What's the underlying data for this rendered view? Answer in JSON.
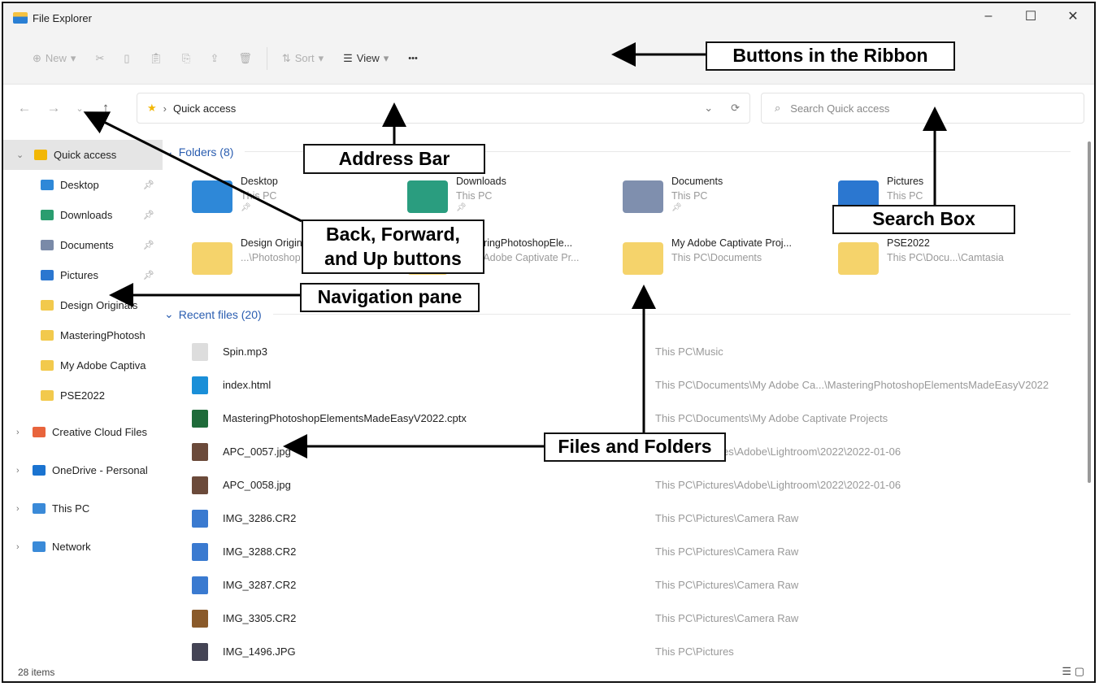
{
  "window": {
    "title": "File Explorer",
    "controls": [
      "–",
      "☐",
      "✕"
    ]
  },
  "ribbon": {
    "new_label": "New",
    "sort_label": "Sort",
    "view_label": "View",
    "more_label": "•••",
    "icons": [
      "cut-icon",
      "copy-icon",
      "paste-icon",
      "rename-icon",
      "share-icon",
      "delete-icon"
    ]
  },
  "address": {
    "location": "Quick access"
  },
  "search": {
    "placeholder": "Search Quick access"
  },
  "nav": {
    "items": [
      {
        "label": "Quick access",
        "color": "#f2b705"
      },
      {
        "label": "Desktop",
        "color": "#2e88d8",
        "pinned": true
      },
      {
        "label": "Downloads",
        "color": "#2a9d6f",
        "pinned": true
      },
      {
        "label": "Documents",
        "color": "#7a8aa8",
        "pinned": true
      },
      {
        "label": "Pictures",
        "color": "#2b77d0",
        "pinned": true
      },
      {
        "label": "Design Originals",
        "color": "#f2c94c"
      },
      {
        "label": "MasteringPhotosh",
        "color": "#f2c94c"
      },
      {
        "label": "My Adobe Captiva",
        "color": "#f2c94c"
      },
      {
        "label": "PSE2022",
        "color": "#f2c94c"
      },
      {
        "label": "Creative Cloud Files",
        "color": "#e8643c"
      },
      {
        "label": "OneDrive - Personal",
        "color": "#1a73d0"
      },
      {
        "label": "This PC",
        "color": "#3a8ad8"
      },
      {
        "label": "Network",
        "color": "#3a8ad8"
      }
    ]
  },
  "folders": {
    "header": "Folders (8)",
    "items": [
      {
        "name": "Desktop",
        "path": "This PC",
        "color": "#2e88d8"
      },
      {
        "name": "Downloads",
        "path": "This PC",
        "color": "#2a9d7f"
      },
      {
        "name": "Documents",
        "path": "This PC",
        "color": "#7f8fae"
      },
      {
        "name": "Pictures",
        "path": "This PC",
        "color": "#2b77d0"
      },
      {
        "name": "Design Originals",
        "path": "...\\Photoshop",
        "color": "#f5d36b"
      },
      {
        "name": "MasteringPhotoshopEle...",
        "path": "...\\My Adobe Captivate Pr...",
        "color": "#f5d36b"
      },
      {
        "name": "My Adobe Captivate Proj...",
        "path": "This PC\\Documents",
        "color": "#f5d36b"
      },
      {
        "name": "PSE2022",
        "path": "This PC\\Docu...\\Camtasia",
        "color": "#f5d36b"
      }
    ]
  },
  "recent": {
    "header": "Recent files (20)",
    "items": [
      {
        "name": "Spin.mp3",
        "path": "This PC\\Music",
        "color": "#ddd"
      },
      {
        "name": "index.html",
        "path": "This PC\\Documents\\My Adobe Ca...\\MasteringPhotoshopElementsMadeEasyV2022",
        "color": "#1a8fd8"
      },
      {
        "name": "MasteringPhotoshopElementsMadeEasyV2022.cptx",
        "path": "This PC\\Documents\\My Adobe Captivate Projects",
        "color": "#1f6b3a"
      },
      {
        "name": "APC_0057.jpg",
        "path": "This PC\\Pictures\\Adobe\\Lightroom\\2022\\2022-01-06",
        "color": "#6b4a3a"
      },
      {
        "name": "APC_0058.jpg",
        "path": "This PC\\Pictures\\Adobe\\Lightroom\\2022\\2022-01-06",
        "color": "#6b4a3a"
      },
      {
        "name": "IMG_3286.CR2",
        "path": "This PC\\Pictures\\Camera Raw",
        "color": "#3a7ad0"
      },
      {
        "name": "IMG_3288.CR2",
        "path": "This PC\\Pictures\\Camera Raw",
        "color": "#3a7ad0"
      },
      {
        "name": "IMG_3287.CR2",
        "path": "This PC\\Pictures\\Camera Raw",
        "color": "#3a7ad0"
      },
      {
        "name": "IMG_3305.CR2",
        "path": "This PC\\Pictures\\Camera Raw",
        "color": "#8a5a2a"
      },
      {
        "name": "IMG_1496.JPG",
        "path": "This PC\\Pictures",
        "color": "#445"
      }
    ]
  },
  "status": {
    "items": "28 items"
  },
  "callouts": {
    "ribbon": "Buttons  in the Ribbon",
    "address": "Address  Bar",
    "search": "Search Box",
    "backfwd_1": "Back, Forward,",
    "backfwd_2": "and Up buttons",
    "nav": "Navigation pane",
    "files": "Files and Folders"
  }
}
